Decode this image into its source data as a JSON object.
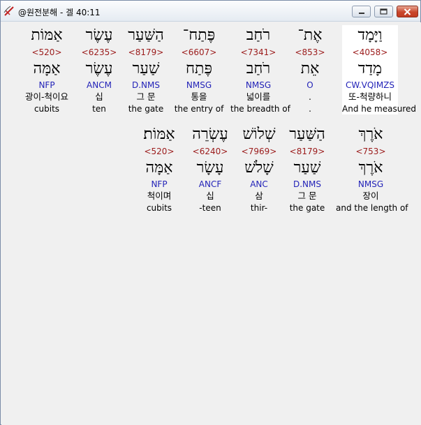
{
  "window": {
    "title": "@원전분해 - 겔 40:11"
  },
  "rows": [
    [
      {
        "hebrew": "וַיָּמָד",
        "strong": "<4058>",
        "lemma": "מָדַד",
        "morph": "CW.VQIMZS",
        "korean": "또-척량하니",
        "english": "And he measured",
        "selected": true
      },
      {
        "hebrew": "אֶת־",
        "strong": "<853>",
        "lemma": "אֵת",
        "morph": "O",
        "korean": ".",
        "english": ".",
        "selected": false
      },
      {
        "hebrew": "רֹחַב",
        "strong": "<7341>",
        "lemma": "רֹחַב",
        "morph": "NMSG",
        "korean": "넓이를",
        "english": "the breadth of",
        "selected": false
      },
      {
        "hebrew": "פֶּתַח־",
        "strong": "<6607>",
        "lemma": "פֶּתַח",
        "morph": "NMSG",
        "korean": "통을",
        "english": "the entry of",
        "selected": false
      },
      {
        "hebrew": "הַשַּׁעַר",
        "strong": "<8179>",
        "lemma": "שַׁעַר",
        "morph": "D.NMS",
        "korean": "그 문",
        "english": "the gate",
        "selected": false
      },
      {
        "hebrew": "עֶשֶׂר",
        "strong": "<6235>",
        "lemma": "עֶשֶׂר",
        "morph": "ANCM",
        "korean": "십",
        "english": "ten",
        "selected": false
      },
      {
        "hebrew": "אַמּוֹת",
        "strong": "<520>",
        "lemma": "אַמָּה",
        "morph": "NFP",
        "korean": "광이-척이요",
        "english": "cubits",
        "selected": false
      }
    ],
    [
      {
        "hebrew": "אֹרֶךְ",
        "strong": "<753>",
        "lemma": "אֹרֶךְ",
        "morph": "NMSG",
        "korean": "장이",
        "english": "and the length of",
        "selected": false
      },
      {
        "hebrew": "הַשַּׁעַר",
        "strong": "<8179>",
        "lemma": "שַׁעַר",
        "morph": "D.NMS",
        "korean": "그 문",
        "english": "the gate",
        "selected": false
      },
      {
        "hebrew": "שְׁלוֹשׁ",
        "strong": "<7969>",
        "lemma": "שָׁלֹשׁ",
        "morph": "ANC",
        "korean": "삼",
        "english": "thir-",
        "selected": false
      },
      {
        "hebrew": "עֶשְׂרֵה",
        "strong": "<6240>",
        "lemma": "עָשָׂר",
        "morph": "ANCF",
        "korean": "십",
        "english": "-teen",
        "selected": false
      },
      {
        "hebrew": "אַמּוֹת׃",
        "strong": "<520>",
        "lemma": "אַמָּה",
        "morph": "NFP",
        "korean": "척이며",
        "english": "cubits",
        "selected": false
      }
    ]
  ]
}
